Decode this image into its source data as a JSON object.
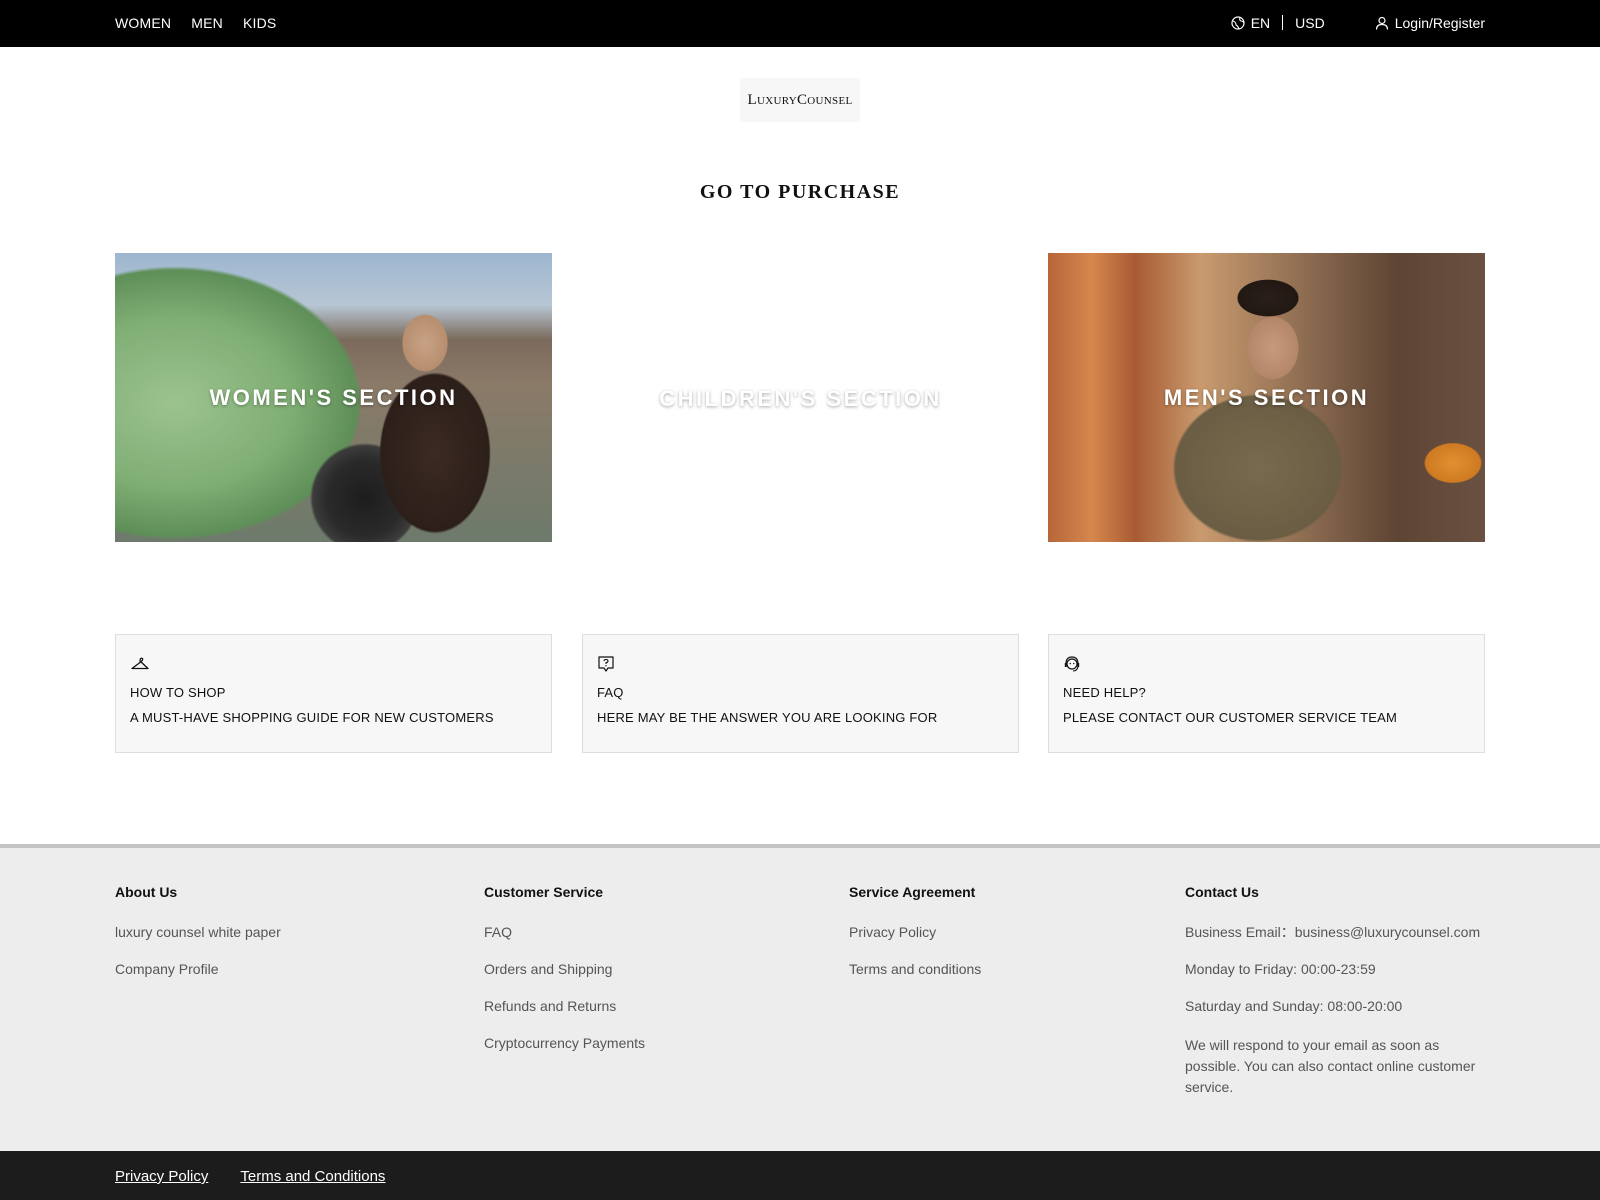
{
  "topbar": {
    "nav": [
      "WOMEN",
      "MEN",
      "KIDS"
    ],
    "language": "EN",
    "currency": "USD",
    "login": "Login/Register"
  },
  "logo": {
    "text": "LuxuryCounsel"
  },
  "heading": "GO TO PURCHASE",
  "categories": [
    {
      "label": "WOMEN'S SECTION"
    },
    {
      "label": "CHILDREN'S SECTION"
    },
    {
      "label": "MEN'S SECTION"
    }
  ],
  "info": [
    {
      "icon": "hanger-icon",
      "title": "HOW TO SHOP",
      "subtitle": "A MUST-HAVE SHOPPING GUIDE FOR NEW CUSTOMERS"
    },
    {
      "icon": "question-bubble-icon",
      "title": "FAQ",
      "subtitle": "HERE MAY BE THE ANSWER YOU ARE LOOKING FOR"
    },
    {
      "icon": "support-agent-icon",
      "title": "NEED HELP?",
      "subtitle": "PLEASE CONTACT OUR CUSTOMER SERVICE TEAM"
    }
  ],
  "footer": {
    "about": {
      "title": "About Us",
      "items": [
        "luxury counsel white paper",
        "Company Profile"
      ]
    },
    "service": {
      "title": "Customer Service",
      "items": [
        "FAQ",
        "Orders and Shipping",
        "Refunds and Returns",
        "Cryptocurrency Payments"
      ]
    },
    "agreement": {
      "title": "Service Agreement",
      "items": [
        "Privacy Policy",
        "Terms and conditions"
      ]
    },
    "contact": {
      "title": "Contact Us",
      "email": "Business Email：business@luxurycounsel.com",
      "weekdays": "Monday to Friday: 00:00-23:59",
      "weekend": "Saturday and Sunday: 08:00-20:00",
      "note": "We will respond to your email as soon as possible. You can also contact online customer service."
    }
  },
  "bottom": {
    "links": [
      "Privacy Policy",
      "Terms and Conditions"
    ]
  },
  "colors": {
    "topbar": "#000000",
    "footer": "#ededed",
    "bottombar": "#1c1c1c"
  }
}
